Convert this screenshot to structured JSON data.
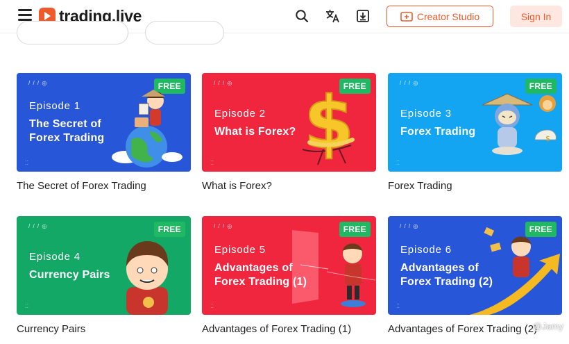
{
  "header": {
    "brand": "trading.live",
    "creator_label": "Creator Studio",
    "signin_label": "Sign In",
    "accent": "#ee5a2a"
  },
  "icons": [
    "menu-icon",
    "search-icon",
    "translate-icon",
    "download-icon",
    "video-add-icon"
  ],
  "cards": [
    {
      "badge": "FREE",
      "episode": "Episode 1",
      "title_line1": "The Secret of",
      "title_line2": "Forex Trading",
      "caption": "The Secret of Forex Trading",
      "bg": "#2856d8"
    },
    {
      "badge": "FREE",
      "episode": "Episode 2",
      "title_line1": "What is Forex?",
      "title_line2": "",
      "caption": "What is Forex?",
      "bg": "#f0263f"
    },
    {
      "badge": "FREE",
      "episode": "Episode 3",
      "title_line1": "Forex Trading",
      "title_line2": "",
      "caption": "Forex Trading",
      "bg": "#13a4f2"
    },
    {
      "badge": "FREE",
      "episode": "Episode 4",
      "title_line1": "Currency Pairs",
      "title_line2": "",
      "caption": "Currency Pairs",
      "bg": "#13a866"
    },
    {
      "badge": "FREE",
      "episode": "Episode 5",
      "title_line1": "Advantages of",
      "title_line2": "Forex Trading (1)",
      "caption": "Advantages of Forex Trading (1)",
      "bg": "#f0263f"
    },
    {
      "badge": "FREE",
      "episode": "Episode 6",
      "title_line1": "Advantages of",
      "title_line2": "Forex Trading (2)",
      "caption": "Advantages of Forex Trading (2)",
      "bg": "#2856d8"
    }
  ],
  "watermark": "@Jamy"
}
